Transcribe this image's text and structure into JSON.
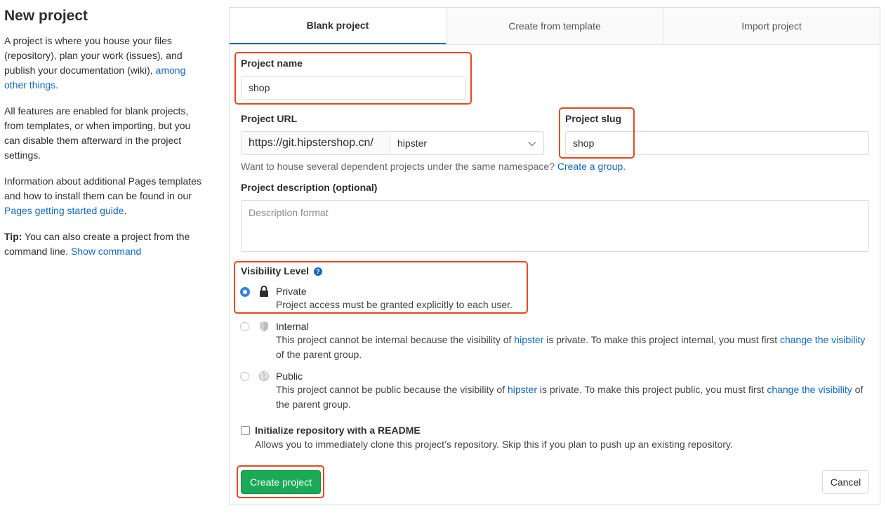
{
  "sidebar": {
    "title": "New project",
    "p1_text": "A project is where you house your files (repository), plan your work (issues), and publish your documentation (wiki), ",
    "p1_link": "among other things",
    "p1_end": ".",
    "p2": "All features are enabled for blank projects, from templates, or when importing, but you can disable them afterward in the project settings.",
    "p3_text": "Information about additional Pages templates and how to install them can be found in our ",
    "p3_link": "Pages getting started guide",
    "p3_end": ".",
    "tip_label": "Tip:",
    "tip_text": " You can also create a project from the command line. ",
    "tip_link": "Show command"
  },
  "tabs": [
    "Blank project",
    "Create from template",
    "Import project"
  ],
  "form": {
    "name_label": "Project name",
    "name_value": "shop",
    "url_label": "Project URL",
    "url_prefix": "https://git.hipstershop.cn/",
    "namespace": "hipster",
    "slug_label": "Project slug",
    "slug_value": "shop",
    "group_help": "Want to house several dependent projects under the same namespace? ",
    "group_link": "Create a group.",
    "desc_label": "Project description (optional)",
    "desc_placeholder": "Description format",
    "visibility_label": "Visibility Level",
    "private_title": "Private",
    "private_desc": "Project access must be granted explicitly to each user.",
    "internal_title": "Internal",
    "internal_desc_a": "This project cannot be internal because the visibility of ",
    "internal_desc_link1": "hipster",
    "internal_desc_b": " is private. To make this project internal, you must first ",
    "internal_desc_link2": "change the visibility",
    "internal_desc_c": " of the parent group.",
    "public_title": "Public",
    "public_desc_a": "This project cannot be public because the visibility of ",
    "public_desc_link1": "hipster",
    "public_desc_b": " is private. To make this project public, you must first ",
    "public_desc_link2": "change the visibility",
    "public_desc_c": " of the parent group.",
    "readme_label": "Initialize repository with a README",
    "readme_desc": "Allows you to immediately clone this project’s repository. Skip this if you plan to push up an existing repository.",
    "create_button": "Create project",
    "cancel_button": "Cancel"
  },
  "colors": {
    "highlight": "#e8481f",
    "create_button_bg": "#1aaa55",
    "link": "#1068bf"
  },
  "icons": [
    "help-icon",
    "lock-icon",
    "shield-icon",
    "globe-icon",
    "chevron-down-icon"
  ]
}
